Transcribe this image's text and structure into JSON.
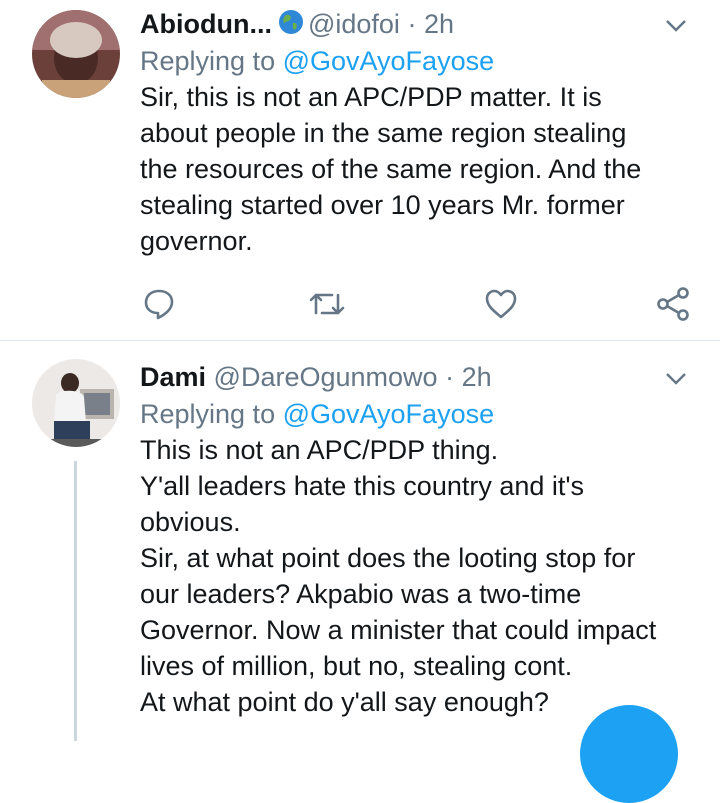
{
  "tweets": [
    {
      "name": "Abiodun...",
      "handle": "@idofoi",
      "separator": "·",
      "time": "2h",
      "replying_prefix": "Replying to ",
      "replying_to": "@GovAyoFayose",
      "text": "Sir, this is not an APC/PDP matter. It is\nabout people in the same region stealing\nthe resources of the same region. And the\nstealing started over 10 years Mr. former\ngovernor."
    },
    {
      "name": "Dami",
      "handle": "@DareOgunmowo",
      "separator": "·",
      "time": "2h",
      "replying_prefix": "Replying to ",
      "replying_to": "@GovAyoFayose",
      "text": "This is not an APC/PDP thing.\nY'all leaders hate this country and it's\nobvious.\nSir, at what point does the looting stop for\nour leaders? Akpabio was a two-time\nGovernor. Now a minister that could impact\nlives of million, but no, stealing cont.\nAt what point do y'all say enough?"
    }
  ],
  "colors": {
    "accent": "#1da1f2",
    "secondary_text": "#657786",
    "divider": "#e1e8ed"
  }
}
